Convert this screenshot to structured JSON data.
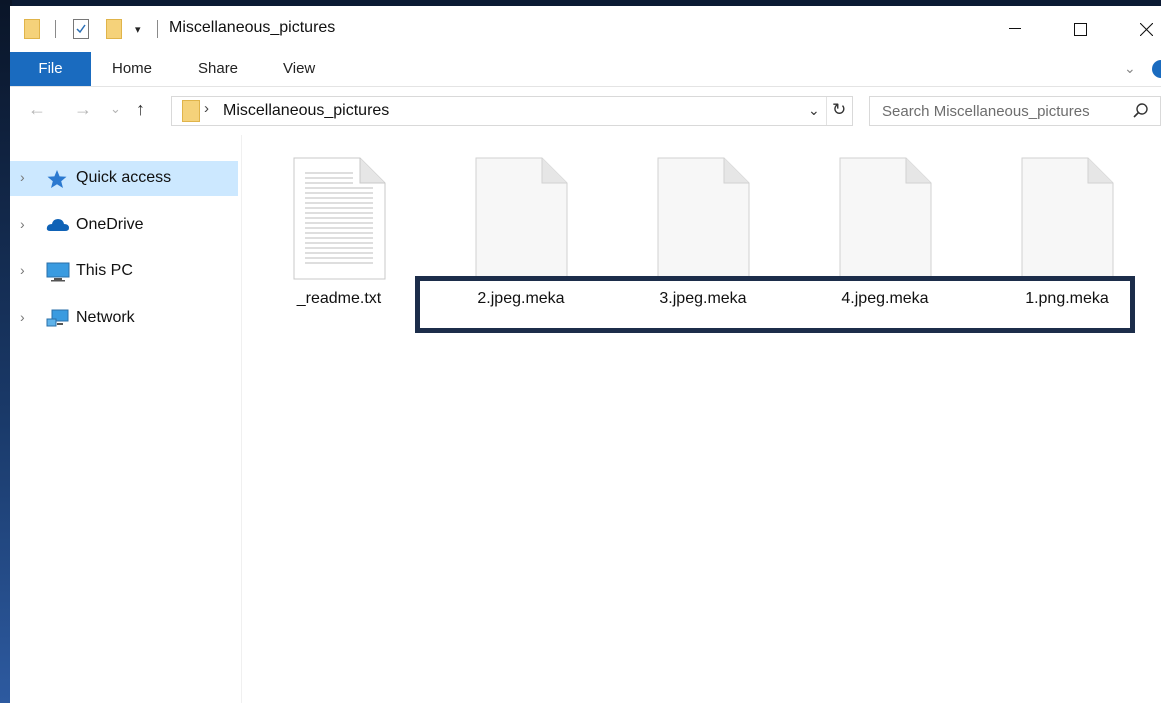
{
  "window": {
    "title": "Miscellaneous_pictures",
    "quick_access_dropdown": "▾",
    "controls": {
      "minimize": "—",
      "maximize": "☐",
      "close": "✕"
    }
  },
  "ribbon": {
    "tabs": [
      "File",
      "Home",
      "Share",
      "View"
    ],
    "expand_glyph": "⌄"
  },
  "address_bar": {
    "back": "←",
    "forward": "→",
    "recent": "⌄",
    "up": "↑",
    "crumb_separator": "›",
    "path": "Miscellaneous_pictures",
    "dropdown": "⌄",
    "refresh": "↻"
  },
  "search": {
    "placeholder": "Search Miscellaneous_pictures"
  },
  "nav_pane": {
    "expander": "›",
    "items": [
      {
        "label": "Quick access",
        "icon": "star-icon",
        "selected": true
      },
      {
        "label": "OneDrive",
        "icon": "cloud-icon",
        "selected": false
      },
      {
        "label": "This PC",
        "icon": "monitor-icon",
        "selected": false
      },
      {
        "label": "Network",
        "icon": "network-icon",
        "selected": false
      }
    ]
  },
  "files": [
    {
      "name": "_readme.txt",
      "icon": "text-document-icon"
    },
    {
      "name": "2.jpeg.meka",
      "icon": "blank-document-icon"
    },
    {
      "name": "3.jpeg.meka",
      "icon": "blank-document-icon"
    },
    {
      "name": "4.jpeg.meka",
      "icon": "blank-document-icon"
    },
    {
      "name": "1.png.meka",
      "icon": "blank-document-icon"
    }
  ],
  "colors": {
    "file_tab": "#1a6bbf",
    "selected_nav": "#cce8ff",
    "highlight_border": "#1c2d4a",
    "folder": "#f5d27a"
  }
}
